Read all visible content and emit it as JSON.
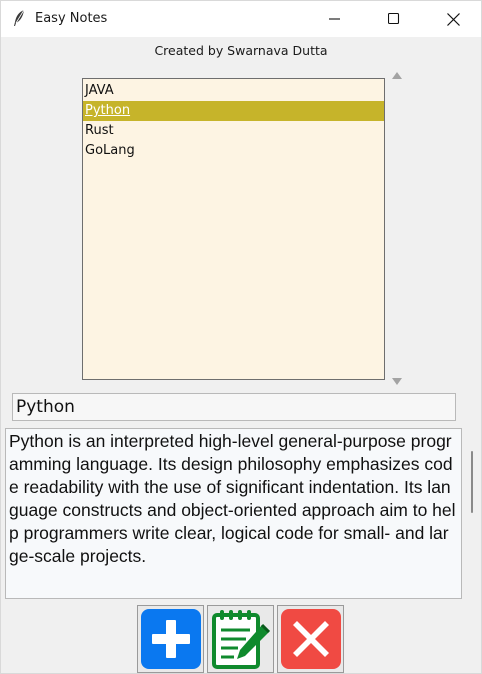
{
  "window": {
    "title": "Easy Notes",
    "icon": "feather-icon"
  },
  "credit": "Created by Swarnava Dutta",
  "notes_list": {
    "items": [
      "JAVA",
      "Python",
      "Rust",
      "GoLang"
    ],
    "selected_index": 1
  },
  "title_field": {
    "value": "Python"
  },
  "note_body": {
    "value": "Python is an interpreted high-level general-purpose programming language. Its design philosophy emphasizes code readability with the use of significant indentation. Its language constructs and object-oriented approach aim to help programmers write clear, logical code for small- and large-scale projects."
  },
  "actions": {
    "add_icon": "plus-icon",
    "edit_icon": "notepad-edit-icon",
    "delete_icon": "x-icon"
  },
  "colors": {
    "list_bg": "#fdf4e3",
    "selection": "#c6b42a",
    "add_blue": "#0a78f0",
    "edit_green": "#0f8a2d",
    "delete_red": "#f04a43"
  }
}
